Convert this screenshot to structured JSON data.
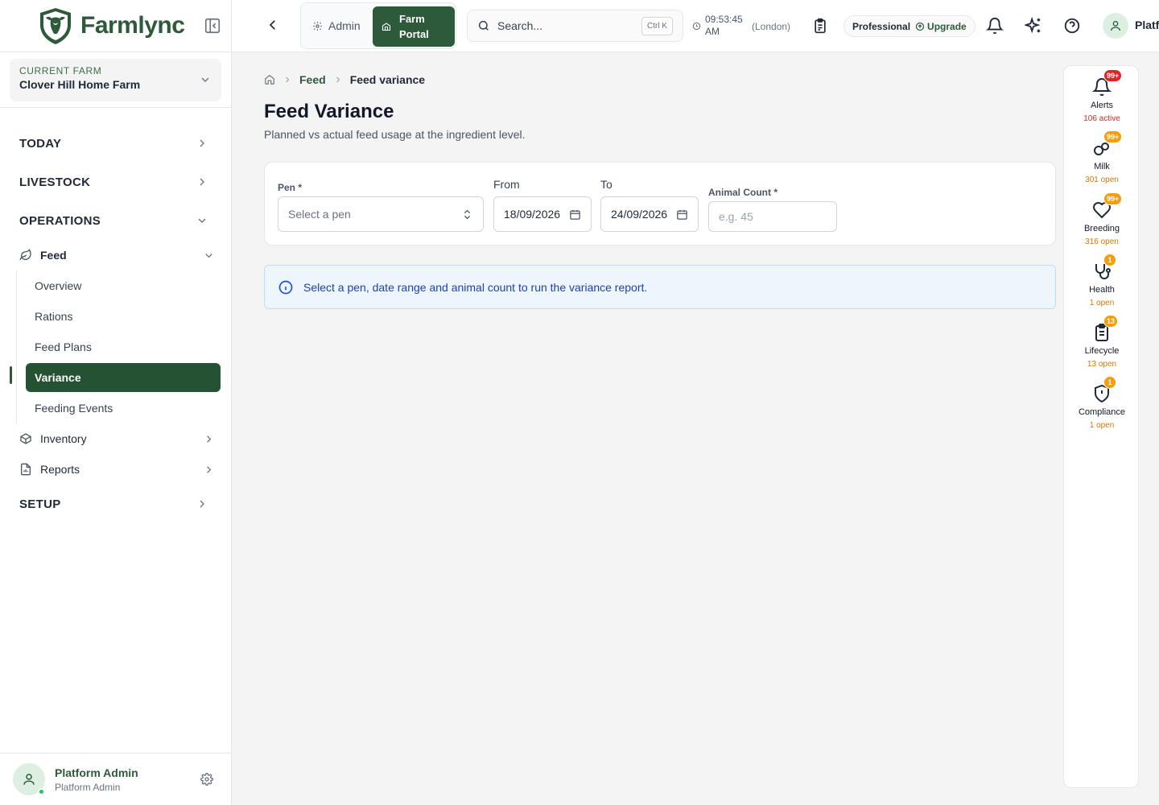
{
  "brand": {
    "name": "Farmlync"
  },
  "farm": {
    "label": "CURRENT FARM",
    "name": "Clover Hill Home Farm"
  },
  "nav": {
    "today": "TODAY",
    "livestock": "LIVESTOCK",
    "operations": "OPERATIONS",
    "feed": "Feed",
    "feed_items": [
      "Overview",
      "Rations",
      "Feed Plans",
      "Variance",
      "Feeding Events"
    ],
    "inventory": "Inventory",
    "reports": "Reports",
    "setup": "SETUP"
  },
  "user": {
    "name": "Platform Admin",
    "role": "Platform Admin"
  },
  "topbar": {
    "admin_label": "Admin",
    "farm_portal_label": "Farm Portal",
    "search_placeholder": "Search...",
    "search_shortcut": "Ctrl K",
    "time": "09:53:45 AM",
    "timezone": "(London)",
    "plan": "Professional",
    "upgrade": "Upgrade",
    "user_name": "Platf"
  },
  "breadcrumb": {
    "section": "Feed",
    "current": "Feed variance"
  },
  "page": {
    "title": "Feed Variance",
    "subtitle": "Planned vs actual feed usage at the ingredient level."
  },
  "filters": {
    "pen_label": "Pen *",
    "pen_placeholder": "Select a pen",
    "from_label": "From",
    "from_value": "18/09/2026",
    "to_label": "To",
    "to_value": "24/09/2026",
    "count_label": "Animal Count *",
    "count_placeholder": "e.g. 45"
  },
  "info": {
    "message": "Select a pen, date range and animal count to run the variance report."
  },
  "rail": [
    {
      "label": "Alerts",
      "badge": "99+",
      "count": "106 active",
      "badge_color": "#dc2626",
      "count_color": "#dc2626"
    },
    {
      "label": "Milk",
      "badge": "99+",
      "count": "301 open",
      "badge_color": "#f59e0b",
      "count_color": "#d97706"
    },
    {
      "label": "Breeding",
      "badge": "99+",
      "count": "316 open",
      "badge_color": "#f59e0b",
      "count_color": "#d97706"
    },
    {
      "label": "Health",
      "badge": "1",
      "count": "1 open",
      "badge_color": "#f59e0b",
      "count_color": "#d97706"
    },
    {
      "label": "Lifecycle",
      "badge": "13",
      "count": "13 open",
      "badge_color": "#f59e0b",
      "count_color": "#d97706"
    },
    {
      "label": "Compliance",
      "badge": "1",
      "count": "1 open",
      "badge_color": "#f59e0b",
      "count_color": "#d97706"
    }
  ]
}
